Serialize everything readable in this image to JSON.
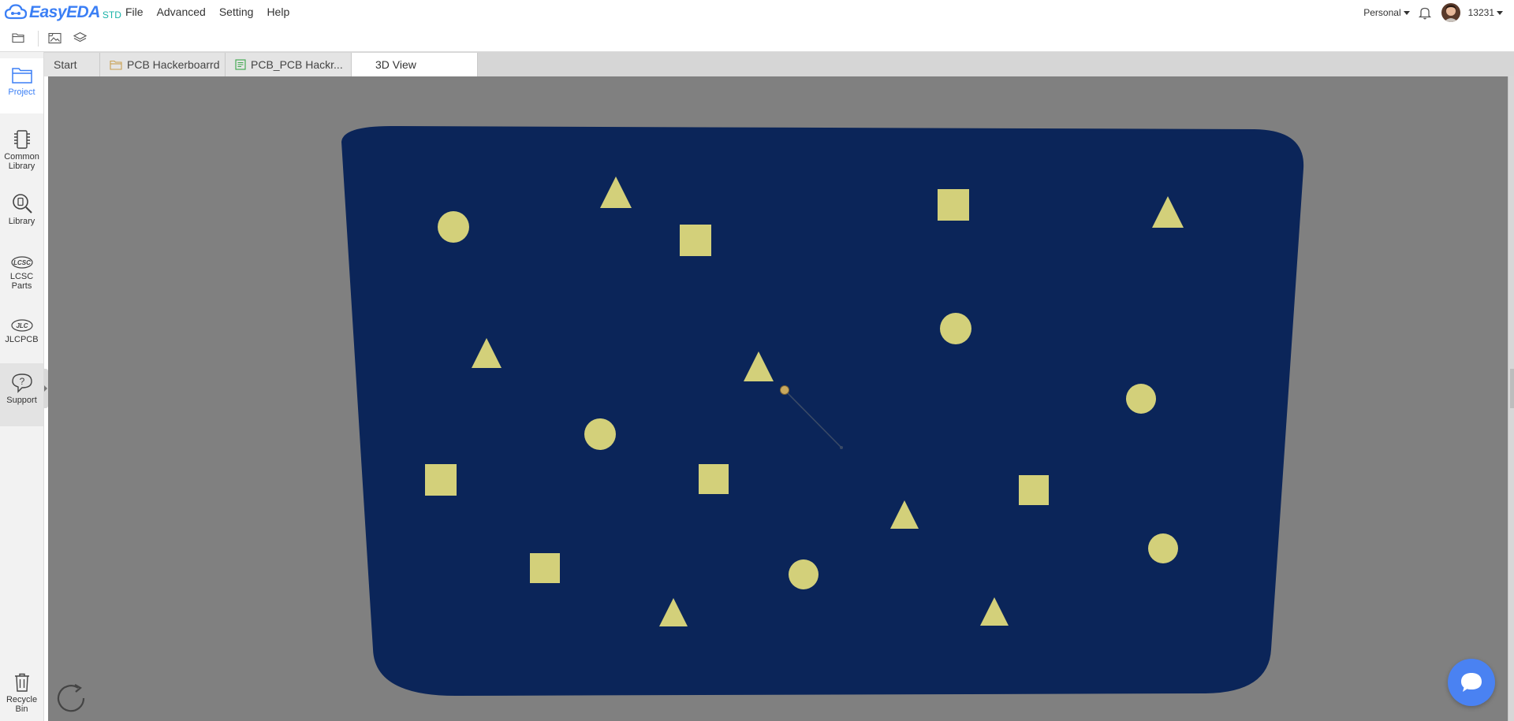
{
  "app": {
    "logo_text": "EasyEDA",
    "logo_suffix": "STD",
    "brand_color": "#3b7ff5"
  },
  "menu": [
    "File",
    "Advanced",
    "Setting",
    "Help"
  ],
  "account": {
    "workspace": "Personal",
    "user_id": "13231",
    "icons": [
      "bell-icon",
      "avatar"
    ]
  },
  "toolbar": {
    "icons": [
      "open-folder-icon",
      "image-icon",
      "layers-icon"
    ]
  },
  "sidebar": {
    "items": [
      {
        "label": "Project",
        "icon": "folder-icon"
      },
      {
        "label": "Common Library",
        "icon": "chip-icon"
      },
      {
        "label": "Library",
        "icon": "search-chip-icon"
      },
      {
        "label": "LCSC Parts",
        "icon": "lcsc-icon"
      },
      {
        "label": "JLCPCB",
        "icon": "jlc-icon"
      },
      {
        "label": "Support",
        "icon": "question-icon"
      },
      {
        "label": "Recycle Bin",
        "icon": "trash-icon"
      }
    ],
    "active": "Project"
  },
  "tabs": [
    {
      "label": "Start",
      "icon": ""
    },
    {
      "label": "PCB Hackerboarrd",
      "icon": "folder-icon"
    },
    {
      "label": "PCB_PCB Hackr...",
      "icon": "pcb-icon"
    },
    {
      "label": "3D View",
      "icon": ""
    }
  ],
  "active_tab": "3D View",
  "viewport": {
    "background_color": "#808080",
    "board_color": "#0b2559",
    "pad_color": "#d3d07a",
    "pads": [
      {
        "shape": "circle"
      },
      {
        "shape": "triangle"
      },
      {
        "shape": "square"
      },
      {
        "shape": "square"
      },
      {
        "shape": "triangle"
      },
      {
        "shape": "triangle"
      },
      {
        "shape": "triangle"
      },
      {
        "shape": "circle"
      },
      {
        "shape": "circle"
      },
      {
        "shape": "circle"
      },
      {
        "shape": "square"
      },
      {
        "shape": "square"
      },
      {
        "shape": "triangle"
      },
      {
        "shape": "square"
      },
      {
        "shape": "square"
      },
      {
        "shape": "circle"
      },
      {
        "shape": "circle"
      },
      {
        "shape": "triangle"
      },
      {
        "shape": "triangle"
      }
    ]
  },
  "floating": {
    "refresh_icon": "refresh-icon",
    "chat_icon": "chat-bubble-icon"
  }
}
